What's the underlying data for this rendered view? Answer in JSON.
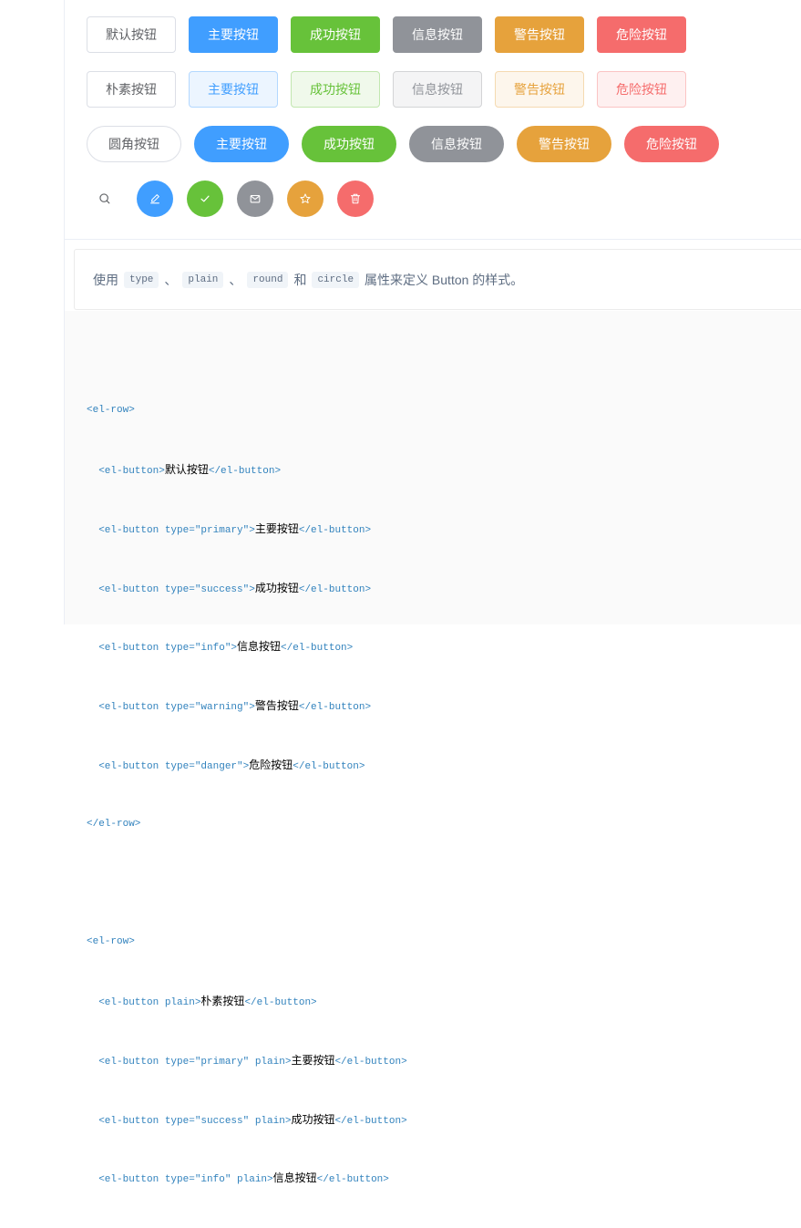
{
  "rows": {
    "default": [
      "默认按钮",
      "主要按钮",
      "成功按钮",
      "信息按钮",
      "警告按钮",
      "危险按钮"
    ],
    "plain": [
      "朴素按钮",
      "主要按钮",
      "成功按钮",
      "信息按钮",
      "警告按钮",
      "危险按钮"
    ],
    "round": [
      "圆角按钮",
      "主要按钮",
      "成功按钮",
      "信息按钮",
      "警告按钮",
      "危险按钮"
    ]
  },
  "circle_icons": [
    "search-icon",
    "edit-icon",
    "check-icon",
    "message-icon",
    "star-icon",
    "delete-icon"
  ],
  "description": {
    "prefix": "使用",
    "code1": "type",
    "sep1": "、",
    "code2": "plain",
    "sep2": "、",
    "code3": "round",
    "and": "和",
    "code4": "circle",
    "suffix": "属性来定义 Button 的样式。"
  },
  "code": {
    "l1": "<el-row>",
    "l2a": "  <el-button>",
    "l2b": "默认按钮",
    "l2c": "</el-button>",
    "l3a": "  <el-button type=\"primary\">",
    "l3b": "主要按钮",
    "l3c": "</el-button>",
    "l4a": "  <el-button type=\"success\">",
    "l4b": "成功按钮",
    "l4c": "</el-button>",
    "l5a": "  <el-button type=\"info\">",
    "l5b": "信息按钮",
    "l5c": "</el-button>",
    "l6a": "  <el-button type=\"warning\">",
    "l6b": "警告按钮",
    "l6c": "</el-button>",
    "l7a": "  <el-button type=\"danger\">",
    "l7b": "危险按钮",
    "l7c": "</el-button>",
    "l8": "</el-row>",
    "l10": "<el-row>",
    "l11a": "  <el-button plain>",
    "l11b": "朴素按钮",
    "l11c": "</el-button>",
    "l12a": "  <el-button type=\"primary\" plain>",
    "l12b": "主要按钮",
    "l12c": "</el-button>",
    "l13a": "  <el-button type=\"success\" plain>",
    "l13b": "成功按钮",
    "l13c": "</el-button>",
    "l14a": "  <el-button type=\"info\" plain>",
    "l14b": "信息按钮",
    "l14c": "</el-button>"
  },
  "colors": {
    "primary": "#409eff",
    "success": "#67c23a",
    "info": "#909399",
    "warning": "#e6a23c",
    "danger": "#f56c6c"
  }
}
